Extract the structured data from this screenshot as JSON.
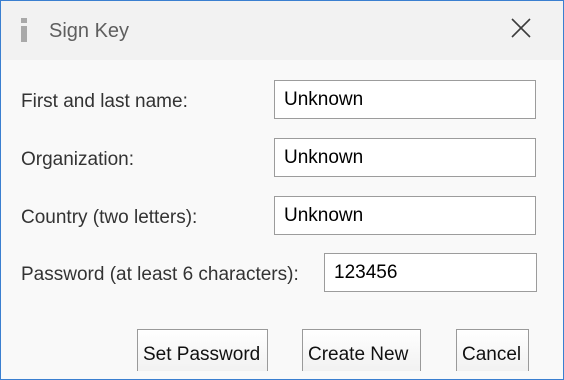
{
  "window": {
    "title": "Sign Key",
    "title_icon": "info-icon",
    "close_icon": "close-icon",
    "accent_color": "#3a7fd0"
  },
  "form": {
    "name_label": "First and last name:",
    "name_value": "Unknown",
    "org_label": "Organization:",
    "org_value": "Unknown",
    "country_label": "Country (two letters):",
    "country_value": "Unknown",
    "password_label": "Password (at least 6 characters):",
    "password_value": "123456"
  },
  "buttons": {
    "set_password": "Set Password",
    "create_new": "Create New",
    "cancel": "Cancel"
  }
}
